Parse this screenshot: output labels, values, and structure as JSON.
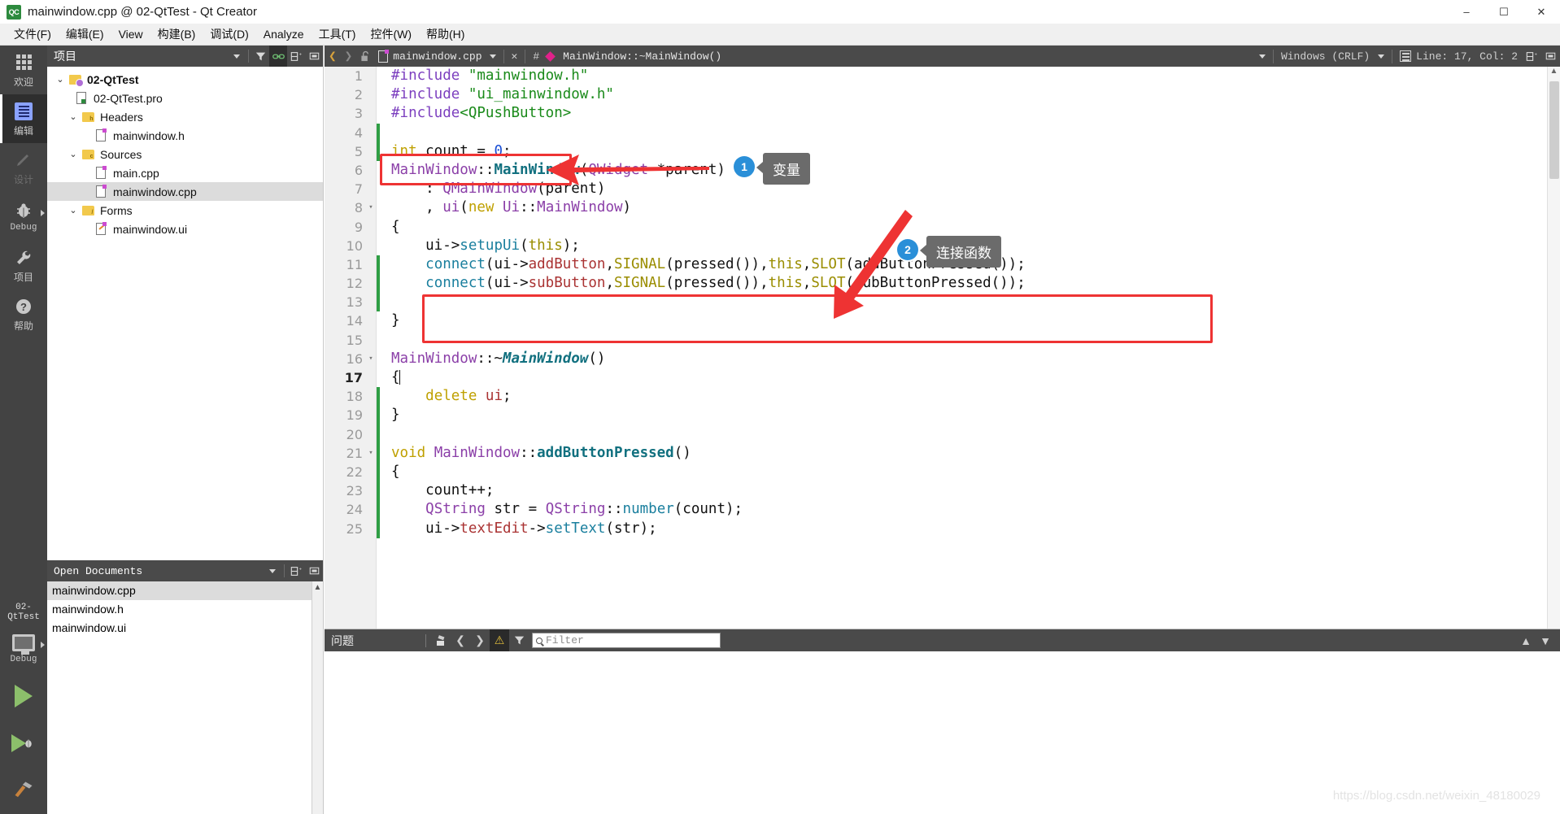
{
  "window": {
    "title": "mainwindow.cpp @ 02-QtTest - Qt Creator",
    "app_icon_text": "QC",
    "minimize": "–",
    "maximize": "☐",
    "close": "✕"
  },
  "menubar": {
    "items": [
      {
        "label": "文件(F)"
      },
      {
        "label": "编辑(E)"
      },
      {
        "label": "View"
      },
      {
        "label": "构建(B)"
      },
      {
        "label": "调试(D)"
      },
      {
        "label": "Analyze"
      },
      {
        "label": "工具(T)"
      },
      {
        "label": "控件(W)"
      },
      {
        "label": "帮助(H)"
      }
    ]
  },
  "modebar": {
    "items": [
      {
        "label": "欢迎",
        "icon": "grid-icon",
        "state": "normal"
      },
      {
        "label": "编辑",
        "icon": "edit-icon",
        "state": "active"
      },
      {
        "label": "设计",
        "icon": "pencil-icon",
        "state": "disabled"
      },
      {
        "label": "Debug",
        "icon": "bug-icon",
        "state": "normal"
      },
      {
        "label": "项目",
        "icon": "wrench-icon",
        "state": "normal"
      },
      {
        "label": "帮助",
        "icon": "help-icon",
        "state": "normal"
      }
    ],
    "kit": {
      "project": "02-QtTest",
      "config": "Debug"
    }
  },
  "project_dock": {
    "title": "项目",
    "tree": [
      {
        "depth": 0,
        "twisty": "⌄",
        "icon": "project-folder-icon",
        "label": "02-QtTest",
        "bold": true,
        "selected": false
      },
      {
        "depth": 1,
        "twisty": "",
        "icon": "pro-file-icon",
        "label": "02-QtTest.pro",
        "bold": false,
        "selected": false
      },
      {
        "depth": 1,
        "twisty": "⌄",
        "icon": "headers-folder-icon",
        "label": "Headers",
        "bold": false,
        "selected": false
      },
      {
        "depth": 2,
        "twisty": "",
        "icon": "header-file-icon",
        "label": "mainwindow.h",
        "bold": false,
        "selected": false
      },
      {
        "depth": 1,
        "twisty": "⌄",
        "icon": "sources-folder-icon",
        "label": "Sources",
        "bold": false,
        "selected": false
      },
      {
        "depth": 2,
        "twisty": "",
        "icon": "cpp-file-icon",
        "label": "main.cpp",
        "bold": false,
        "selected": false
      },
      {
        "depth": 2,
        "twisty": "",
        "icon": "cpp-file-icon",
        "label": "mainwindow.cpp",
        "bold": false,
        "selected": true
      },
      {
        "depth": 1,
        "twisty": "⌄",
        "icon": "forms-folder-icon",
        "label": "Forms",
        "bold": false,
        "selected": false
      },
      {
        "depth": 2,
        "twisty": "",
        "icon": "ui-file-icon",
        "label": "mainwindow.ui",
        "bold": false,
        "selected": false
      }
    ]
  },
  "open_documents": {
    "title": "Open Documents",
    "items": [
      {
        "label": "mainwindow.cpp",
        "selected": true
      },
      {
        "label": "mainwindow.h",
        "selected": false
      },
      {
        "label": "mainwindow.ui",
        "selected": false
      }
    ]
  },
  "editor_toolbar": {
    "file_name": "mainwindow.cpp",
    "hash": "#",
    "symbol": "MainWindow::~MainWindow()",
    "line_ending": "Windows (CRLF)",
    "cursor": "Line: 17, Col: 2",
    "close_label": "✕"
  },
  "code": {
    "lines": [
      {
        "n": "1",
        "fold": "",
        "mark": "",
        "current": false,
        "tokens": [
          {
            "t": "#include ",
            "c": "k-pre"
          },
          {
            "t": "\"mainwindow.h\"",
            "c": "k-str"
          }
        ]
      },
      {
        "n": "2",
        "fold": "",
        "mark": "",
        "current": false,
        "tokens": [
          {
            "t": "#include ",
            "c": "k-pre"
          },
          {
            "t": "\"ui_mainwindow.h\"",
            "c": "k-str"
          }
        ]
      },
      {
        "n": "3",
        "fold": "",
        "mark": "",
        "current": false,
        "tokens": [
          {
            "t": "#include",
            "c": "k-pre"
          },
          {
            "t": "<QPushButton>",
            "c": "k-str"
          }
        ]
      },
      {
        "n": "4",
        "fold": "",
        "mark": "g",
        "current": false,
        "tokens": []
      },
      {
        "n": "5",
        "fold": "",
        "mark": "g",
        "current": false,
        "tokens": [
          {
            "t": "int",
            "c": "k-type"
          },
          {
            "t": " count ",
            "c": "k-plain"
          },
          {
            "t": "=",
            "c": "k-plain"
          },
          {
            "t": " ",
            "c": "k-plain"
          },
          {
            "t": "0",
            "c": "k-num"
          },
          {
            "t": ";",
            "c": "k-plain"
          }
        ]
      },
      {
        "n": "6",
        "fold": "",
        "mark": "",
        "current": false,
        "tokens": [
          {
            "t": "MainWindow",
            "c": "k-cls"
          },
          {
            "t": "::",
            "c": "k-op"
          },
          {
            "t": "MainWindow",
            "c": "k-fnb"
          },
          {
            "t": "(",
            "c": "k-plain"
          },
          {
            "t": "QWidget",
            "c": "k-cls"
          },
          {
            "t": " *parent)",
            "c": "k-plain"
          }
        ]
      },
      {
        "n": "7",
        "fold": "",
        "mark": "",
        "current": false,
        "tokens": [
          {
            "t": "    : ",
            "c": "k-plain"
          },
          {
            "t": "QMainWindow",
            "c": "k-cls"
          },
          {
            "t": "(parent)",
            "c": "k-plain"
          }
        ]
      },
      {
        "n": "8",
        "fold": "▾",
        "mark": "",
        "current": false,
        "tokens": [
          {
            "t": "    , ",
            "c": "k-plain"
          },
          {
            "t": "ui",
            "c": "k-var"
          },
          {
            "t": "(",
            "c": "k-plain"
          },
          {
            "t": "new",
            "c": "k-type"
          },
          {
            "t": " ",
            "c": "k-plain"
          },
          {
            "t": "Ui",
            "c": "k-cls"
          },
          {
            "t": "::",
            "c": "k-op"
          },
          {
            "t": "MainWindow",
            "c": "k-cls"
          },
          {
            "t": ")",
            "c": "k-plain"
          }
        ]
      },
      {
        "n": "9",
        "fold": "",
        "mark": "",
        "current": false,
        "tokens": [
          {
            "t": "{",
            "c": "k-plain"
          }
        ]
      },
      {
        "n": "10",
        "fold": "",
        "mark": "",
        "current": false,
        "tokens": [
          {
            "t": "    ui->",
            "c": "k-plain"
          },
          {
            "t": "setupUi",
            "c": "k-fn"
          },
          {
            "t": "(",
            "c": "k-plain"
          },
          {
            "t": "this",
            "c": "k-this"
          },
          {
            "t": ");",
            "c": "k-plain"
          }
        ]
      },
      {
        "n": "11",
        "fold": "",
        "mark": "g",
        "current": false,
        "tokens": [
          {
            "t": "    ",
            "c": "k-plain"
          },
          {
            "t": "connect",
            "c": "k-fn"
          },
          {
            "t": "(ui->",
            "c": "k-plain"
          },
          {
            "t": "addButton",
            "c": "k-red"
          },
          {
            "t": ",",
            "c": "k-plain"
          },
          {
            "t": "SIGNAL",
            "c": "k-macro"
          },
          {
            "t": "(pressed()),",
            "c": "k-plain"
          },
          {
            "t": "this",
            "c": "k-this"
          },
          {
            "t": ",",
            "c": "k-plain"
          },
          {
            "t": "SLOT",
            "c": "k-macro"
          },
          {
            "t": "(addButtonPressed());",
            "c": "k-plain"
          }
        ]
      },
      {
        "n": "12",
        "fold": "",
        "mark": "g",
        "current": false,
        "tokens": [
          {
            "t": "    ",
            "c": "k-plain"
          },
          {
            "t": "connect",
            "c": "k-fn"
          },
          {
            "t": "(ui->",
            "c": "k-plain"
          },
          {
            "t": "subButton",
            "c": "k-red"
          },
          {
            "t": ",",
            "c": "k-plain"
          },
          {
            "t": "SIGNAL",
            "c": "k-macro"
          },
          {
            "t": "(pressed()),",
            "c": "k-plain"
          },
          {
            "t": "this",
            "c": "k-this"
          },
          {
            "t": ",",
            "c": "k-plain"
          },
          {
            "t": "SLOT",
            "c": "k-macro"
          },
          {
            "t": "(subButtonPressed());",
            "c": "k-plain"
          }
        ]
      },
      {
        "n": "13",
        "fold": "",
        "mark": "g",
        "current": false,
        "tokens": []
      },
      {
        "n": "14",
        "fold": "",
        "mark": "",
        "current": false,
        "tokens": [
          {
            "t": "}",
            "c": "k-plain"
          }
        ]
      },
      {
        "n": "15",
        "fold": "",
        "mark": "",
        "current": false,
        "tokens": []
      },
      {
        "n": "16",
        "fold": "▾",
        "mark": "",
        "current": false,
        "tokens": [
          {
            "t": "MainWindow",
            "c": "k-cls"
          },
          {
            "t": "::~",
            "c": "k-op"
          },
          {
            "t": "MainWindow",
            "c": "k-fni"
          },
          {
            "t": "()",
            "c": "k-plain"
          }
        ]
      },
      {
        "n": "17",
        "fold": "",
        "mark": "",
        "current": true,
        "tokens": [
          {
            "t": "{",
            "c": "k-plain"
          }
        ]
      },
      {
        "n": "18",
        "fold": "",
        "mark": "g",
        "current": false,
        "tokens": [
          {
            "t": "    ",
            "c": "k-plain"
          },
          {
            "t": "delete",
            "c": "k-type"
          },
          {
            "t": " ",
            "c": "k-plain"
          },
          {
            "t": "ui",
            "c": "k-red"
          },
          {
            "t": ";",
            "c": "k-plain"
          }
        ]
      },
      {
        "n": "19",
        "fold": "",
        "mark": "g",
        "current": false,
        "tokens": [
          {
            "t": "}",
            "c": "k-plain"
          }
        ]
      },
      {
        "n": "20",
        "fold": "",
        "mark": "g",
        "current": false,
        "tokens": []
      },
      {
        "n": "21",
        "fold": "▾",
        "mark": "g",
        "current": false,
        "tokens": [
          {
            "t": "void",
            "c": "k-type"
          },
          {
            "t": " ",
            "c": "k-plain"
          },
          {
            "t": "MainWindow",
            "c": "k-cls"
          },
          {
            "t": "::",
            "c": "k-op"
          },
          {
            "t": "addButtonPressed",
            "c": "k-fnb"
          },
          {
            "t": "()",
            "c": "k-plain"
          }
        ]
      },
      {
        "n": "22",
        "fold": "",
        "mark": "g",
        "current": false,
        "tokens": [
          {
            "t": "{",
            "c": "k-plain"
          }
        ]
      },
      {
        "n": "23",
        "fold": "",
        "mark": "g",
        "current": false,
        "tokens": [
          {
            "t": "    count++;",
            "c": "k-plain"
          }
        ]
      },
      {
        "n": "24",
        "fold": "",
        "mark": "g",
        "current": false,
        "tokens": [
          {
            "t": "    ",
            "c": "k-plain"
          },
          {
            "t": "QString",
            "c": "k-cls"
          },
          {
            "t": " str ",
            "c": "k-plain"
          },
          {
            "t": "=",
            "c": "k-plain"
          },
          {
            "t": " ",
            "c": "k-plain"
          },
          {
            "t": "QString",
            "c": "k-cls"
          },
          {
            "t": "::",
            "c": "k-op"
          },
          {
            "t": "number",
            "c": "k-fn"
          },
          {
            "t": "(count);",
            "c": "k-plain"
          }
        ]
      },
      {
        "n": "25",
        "fold": "",
        "mark": "g",
        "current": false,
        "tokens": [
          {
            "t": "    ui->",
            "c": "k-plain"
          },
          {
            "t": "textEdit",
            "c": "k-red"
          },
          {
            "t": "->",
            "c": "k-plain"
          },
          {
            "t": "setText",
            "c": "k-fn"
          },
          {
            "t": "(str);",
            "c": "k-plain"
          }
        ]
      }
    ]
  },
  "annotations": [
    {
      "number": "1",
      "label": "变量"
    },
    {
      "number": "2",
      "label": "连接函数"
    }
  ],
  "issues_pane": {
    "title": "问题",
    "filter_placeholder": "Filter"
  },
  "watermark": "https://blog.csdn.net/weixin_48180029",
  "colors": {
    "accent_blue": "#2a8fd8",
    "highlight_red": "#ee3333",
    "dark_chrome": "#4a4a4a",
    "modebar": "#434343",
    "run_green": "#8cbf6b"
  }
}
